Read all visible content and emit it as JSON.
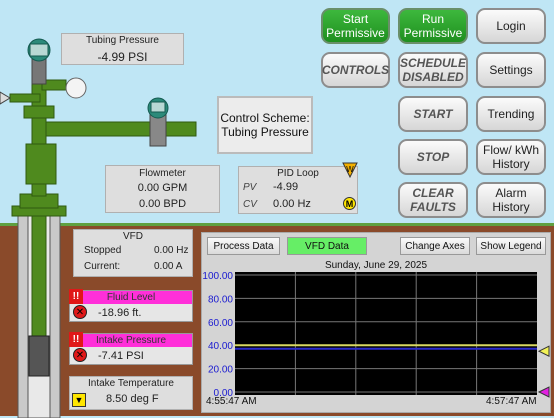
{
  "tubing_pressure": {
    "label": "Tubing Pressure",
    "value": "-4.99 PSI"
  },
  "control_scheme": {
    "line1": "Control Scheme:",
    "line2": "Tubing Pressure"
  },
  "flowmeter": {
    "label": "Flowmeter",
    "gpm": "0.00 GPM",
    "bpd": "0.00 BPD"
  },
  "pid_loop": {
    "label": "PID Loop",
    "pv_label": "PV",
    "pv_value": "-4.99",
    "cv_label": "CV",
    "cv_value": "0.00 Hz",
    "mode_badge": "M"
  },
  "buttons": {
    "start_permissive": "Start Permissive",
    "run_permissive": "Run Permissive",
    "login": "Login",
    "controls": "CONTROLS",
    "schedule_disabled": "SCHEDULE DISABLED",
    "settings": "Settings",
    "start": "START",
    "trending": "Trending",
    "stop": "STOP",
    "flow_kwh_history": "Flow/ kWh History",
    "clear_faults": "CLEAR FAULTS",
    "alarm_history": "Alarm History"
  },
  "vfd": {
    "label": "VFD",
    "status": "Stopped",
    "freq": "0.00 Hz",
    "current_label": "Current:",
    "current": "0.00 A"
  },
  "fluid_level": {
    "label": "Fluid Level",
    "value": "-18.96 ft."
  },
  "intake_pressure": {
    "label": "Intake Pressure",
    "value": "-7.41 PSI"
  },
  "intake_temperature": {
    "label": "Intake Temperature",
    "value": "8.50 deg F"
  },
  "trend": {
    "tabs": {
      "process": "Process Data",
      "vfd": "VFD Data",
      "change_axes": "Change Axes",
      "show_legend": "Show Legend"
    },
    "date": "Sunday, June 29, 2025",
    "y_ticks": [
      "100.00",
      "80.00",
      "60.00",
      "40.00",
      "20.00",
      "0.00"
    ],
    "x_start": "4:55:47 AM",
    "x_end": "4:57:47 AM",
    "colors": {
      "active_tab": "#66ee66",
      "series1": "#d8d860",
      "series2": "#2a2acc",
      "marker1": "#f2f256",
      "marker2": "#e020e0",
      "tick_text": "#1a1ad0"
    }
  },
  "chart_data": {
    "type": "line",
    "title": "",
    "date": "Sunday, June 29, 2025",
    "x": [
      "4:55:47 AM",
      "4:57:47 AM"
    ],
    "ylim": [
      0,
      100
    ],
    "y_ticks": [
      100,
      80,
      60,
      40,
      20,
      0
    ],
    "grid": true,
    "series": [
      {
        "values": [
          40,
          40
        ],
        "color": "#d8d860"
      },
      {
        "values": [
          37,
          37
        ],
        "color": "#2a2acc"
      }
    ]
  }
}
